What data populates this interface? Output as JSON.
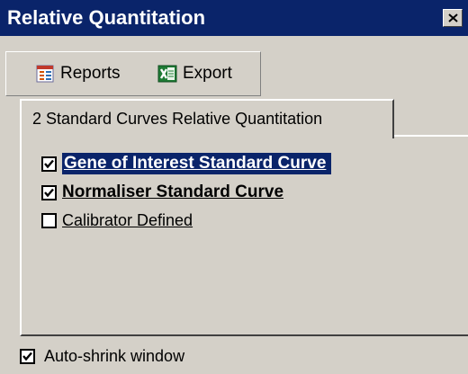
{
  "window": {
    "title": "Relative Quantitation",
    "close_icon": "close-icon"
  },
  "toolbar": {
    "reports_label": "Reports",
    "reports_icon": "report-icon",
    "export_label": "Export",
    "export_icon": "excel-export-icon"
  },
  "tab": {
    "label": "2 Standard Curves Relative Quantitation"
  },
  "curves": [
    {
      "label": "Gene of Interest Standard Curve",
      "checked": true,
      "selected": true
    },
    {
      "label": "Normaliser Standard Curve",
      "checked": true,
      "selected": false
    },
    {
      "label": "Calibrator Defined",
      "checked": false,
      "selected": false
    }
  ],
  "footer": {
    "auto_shrink_label": "Auto-shrink window",
    "auto_shrink_checked": true
  },
  "colors": {
    "titlebar": "#0a246a",
    "face": "#d4d0c8",
    "selection": "#0a246a"
  }
}
